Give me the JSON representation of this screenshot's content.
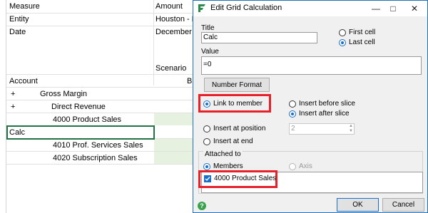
{
  "spreadsheet": {
    "header_rows": [
      {
        "label": "Measure",
        "value": "Amount"
      },
      {
        "label": "Entity",
        "value": "Houston - M"
      },
      {
        "label": "Date",
        "value": "December"
      }
    ],
    "scenario_label": "Scenario",
    "scenario_value_partial": "B",
    "account_header": "Account",
    "rows": [
      {
        "expander": "+",
        "label": "Gross Margin"
      },
      {
        "expander": "+",
        "label": "Direct Revenue"
      },
      {
        "expander": "",
        "label": "4000 Product Sales"
      },
      {
        "expander": "",
        "label": "Calc"
      },
      {
        "expander": "",
        "label": "4010 Prof. Services Sales"
      },
      {
        "expander": "",
        "label": "4020 Subscription Sales"
      }
    ]
  },
  "dialog": {
    "title": "Edit Grid Calculation",
    "title_field_label": "Title",
    "title_value": "Calc",
    "first_cell_label": "First cell",
    "last_cell_label": "Last cell",
    "value_label": "Value",
    "value_text": "=0",
    "number_format_button": "Number Format",
    "link_to_member": "Link to member",
    "insert_before_slice": "Insert before slice",
    "insert_after_slice": "Insert after slice",
    "insert_at_position": "Insert at position",
    "position_value": "2",
    "insert_at_end": "Insert at end",
    "attached_to": "Attached to",
    "members": "Members",
    "axis": "Axis",
    "member_item": "4000 Product Sales",
    "ok": "OK",
    "cancel": "Cancel",
    "status_glyph": "?"
  },
  "colors": {
    "accent": "#1a6fc9",
    "highlight_box": "#e8202a",
    "cell_fill": "#e6f1df",
    "selection": "#217346"
  }
}
